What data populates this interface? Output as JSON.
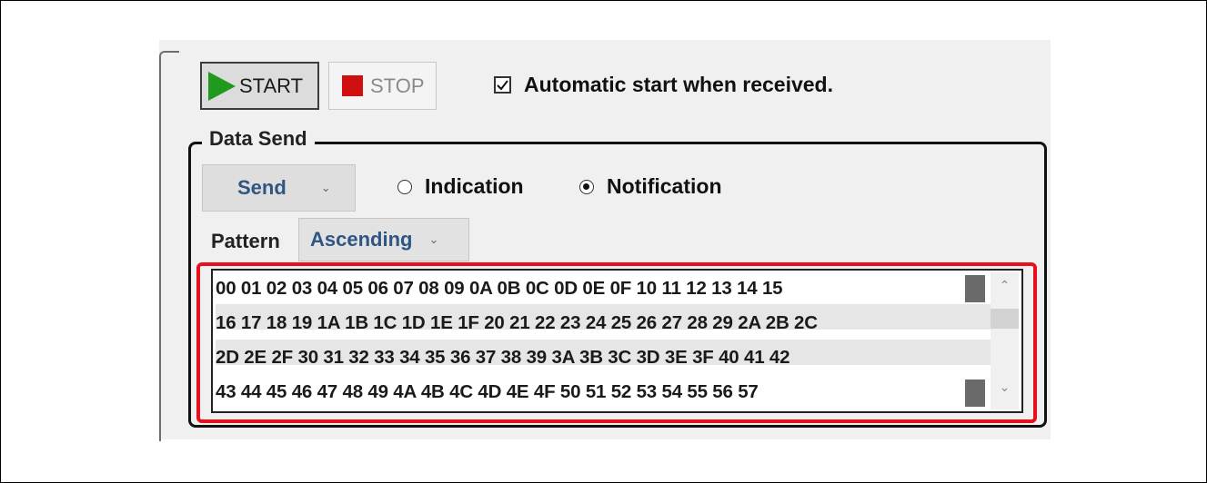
{
  "toolbar": {
    "start_label": "START",
    "stop_label": "STOP",
    "auto_start_label": "Automatic start when received.",
    "auto_start_checked": true
  },
  "data_send": {
    "group_title": "Data Send",
    "mode_select": "Send",
    "radio_indication": "Indication",
    "radio_notification": "Notification",
    "selected_radio": "Notification",
    "pattern_label": "Pattern",
    "pattern_select": "Ascending",
    "data_lines": [
      "00 01 02 03 04 05 06 07 08 09 0A 0B 0C 0D 0E 0F 10 11 12 13 14 15",
      "16 17 18 19 1A 1B 1C 1D 1E 1F 20 21 22 23 24 25 26 27 28 29 2A 2B 2C",
      "2D 2E 2F 30 31 32 33 34 35 36 37 38 39 3A 3B 3C 3D 3E 3F 40 41 42",
      "43 44 45 46 47 48 49 4A 4B 4C 4D 4E 4F 50 51 52 53 54 55 56 57"
    ]
  },
  "colors": {
    "start_icon": "#1f9a1f",
    "stop_icon": "#d01010",
    "highlight": "#e8101c",
    "dropdown_text": "#2f5683"
  },
  "icons": {
    "start": "play-triangle-icon",
    "stop": "stop-square-icon",
    "dropdown": "chevron-down-icon",
    "scroll_up": "chevron-up-icon",
    "scroll_down": "chevron-down-icon"
  }
}
